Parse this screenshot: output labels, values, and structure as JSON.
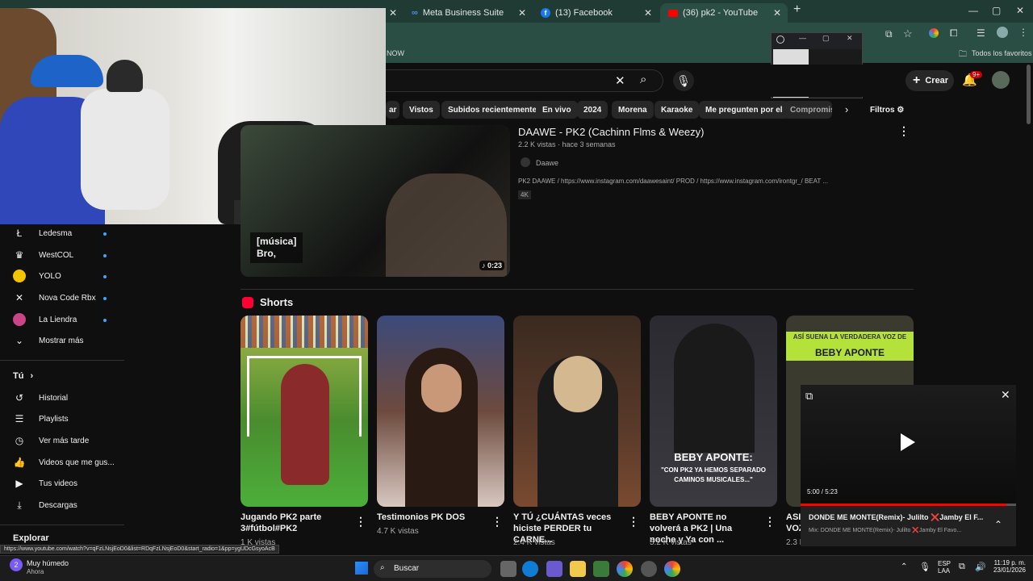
{
  "tabs": [
    {
      "label": "Meta Business Suite"
    },
    {
      "label": "(13) Facebook"
    },
    {
      "label": "(36) pk2 - YouTube"
    }
  ],
  "bookmarks": {
    "left": "NOW",
    "right": "Todos los favoritos"
  },
  "header": {
    "create_label": "Crear",
    "notif_badge": "9+"
  },
  "chips": [
    "ar",
    "Vistos",
    "Subidos recientemente",
    "En vivo",
    "2024",
    "Morena",
    "Karaoke",
    "Me pregunten por el",
    "Compromiso"
  ],
  "filters_label": "Filtros",
  "sidebar": {
    "subs": [
      {
        "label": "Ledesma"
      },
      {
        "label": "WestCOL"
      },
      {
        "label": "YOLO"
      },
      {
        "label": "Nova Code Rbx"
      },
      {
        "label": "La Liendra"
      }
    ],
    "show_more": "Mostrar más",
    "you_header": "Tú",
    "you_items": [
      {
        "label": "Historial"
      },
      {
        "label": "Playlists"
      },
      {
        "label": "Ver más tarde"
      },
      {
        "label": "Videos que me gus..."
      },
      {
        "label": "Tus videos"
      },
      {
        "label": "Descargas"
      }
    ],
    "explore": "Explorar"
  },
  "video": {
    "title": "DAAWE - PK2 (Cachinn Flms & Weezy)",
    "meta": "2.2 K vistas · hace 3 semanas",
    "channel": "Daawe",
    "desc": "PK2 DAAWE / https://www.instagram.com/daawesaint/ PROD / https://www.instagram.com/irontgr_/ BEAT ...",
    "badge": "4K",
    "duration": "0:23",
    "caption1": "[música]",
    "caption2": "Bro,"
  },
  "shorts_title": "Shorts",
  "shorts": [
    {
      "title": "Jugando PK2 parte 3#fútbol#PK2",
      "views": "1 K vistas",
      "color": "#4a8c2e"
    },
    {
      "title": "Testimonios PK DOS",
      "views": "4.7 K vistas",
      "color": "#6d4a3e"
    },
    {
      "title": "Y TÚ ¿CUÁNTAS veces hiciste PERDER tu CARNE...",
      "views": "2.4 K vistas",
      "color": "#4a3226"
    },
    {
      "title": "BEBY APONTE no volverá a PK2 | Una noche y Ya con ...",
      "views": "5.2 K vistas",
      "color": "#2e2e38"
    },
    {
      "title": "ASI VOZ",
      "views": "2.3 K",
      "color": "#3a3a2e"
    }
  ],
  "short_overlays": {
    "s4_a": "BEBY APONTE:",
    "s4_b": "\"CON PK2 YA HEMOS SEPARADO CAMINOS MUSICALES...\"",
    "s5_a": "ASÍ SUENA LA VERDADERA VOZ DE",
    "s5_b": "BEBY APONTE"
  },
  "miniplayer": {
    "time": "5:00 / 5:23",
    "progress": 0.955,
    "title": "DONDE ME MONTE(Remix)- Julilto ❌Jamby El F...",
    "subtitle": "Mix: DONDE ME MONTE(Remix)- Julilto ❌Jamby El Favo..."
  },
  "status_url": "https://www.youtube.com/watch?v=qFzLNsjEoD0&list=RDqFzLNsjEoD0&start_radio=1&pp=ygUDcGsyoAcB",
  "taskbar": {
    "weather_title": "Muy húmedo",
    "weather_sub": "Ahora",
    "weather_temp": "2",
    "search": "Buscar",
    "lang1": "ESP",
    "lang2": "LAA",
    "time": "11:19 p. m.",
    "date": "23/01/2026"
  }
}
